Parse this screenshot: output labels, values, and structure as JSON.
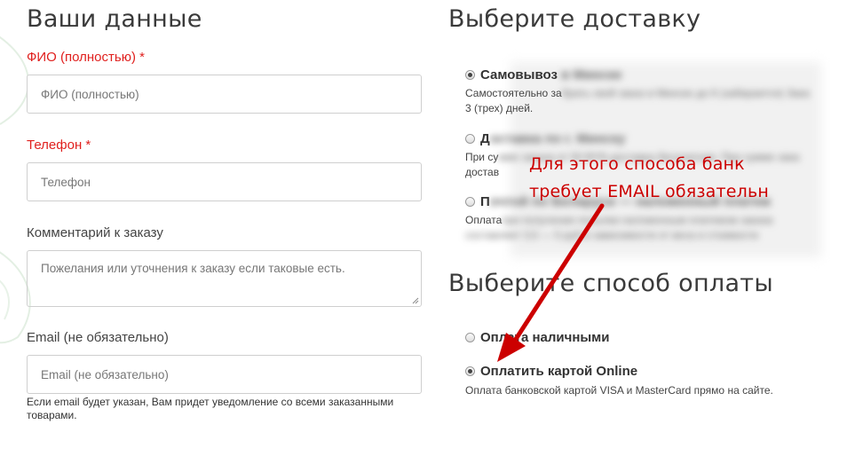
{
  "left": {
    "title": "Ваши данные",
    "fio": {
      "label": "ФИО (полностью)",
      "required": "*",
      "placeholder": "ФИО (полностью)"
    },
    "phone": {
      "label": "Телефон",
      "required": "*",
      "placeholder": "Телефон"
    },
    "comment": {
      "label": "Комментарий к заказу",
      "placeholder": "Пожелания или уточнения к заказу если таковые есть."
    },
    "email": {
      "label": "Email (не обязательно)",
      "placeholder": "Email (не обязательно)",
      "hint": "Если email будет указан, Вам придет уведомление со всеми заказанными товарами."
    }
  },
  "delivery": {
    "title": "Выберите доставку",
    "options": [
      {
        "label": "Самовывоз",
        "label_blurred": "в Минске",
        "selected": true,
        "desc_visible": "Самостоятельно за",
        "desc_blurred": "брать свой заказ в Минске до 6 (забирается) Зака",
        "desc_line2": "3 (трех) дней."
      },
      {
        "label": "Д",
        "label_blurred": "оставка по г. Минску",
        "selected": false,
        "desc_visible": "При су",
        "desc_blurred": "мме заказа от 50 BYN доставка бесплатная. При сумме зака",
        "desc_line2": "достав"
      },
      {
        "label": "П",
        "label_blurred": "очтой по Беларуси — наложенный платеж",
        "selected": false,
        "desc_visible": "Оплата",
        "desc_blurred": "при получении посылки наложенным платежом заказа",
        "desc_line2": "составляет 3,5 — 5 руб в зависимости от веса и стоимости"
      }
    ]
  },
  "payment": {
    "title": "Выберите способ оплаты",
    "options": [
      {
        "label": "Оплата наличными",
        "selected": false
      },
      {
        "label": "Оплатить картой Online",
        "selected": true,
        "desc": "Оплата банковской картой VISA и MasterCard прямо на сайте."
      }
    ]
  },
  "annotation": {
    "line1": "Для этого способа банк",
    "line2": "требует EMAIL обязательн",
    "color": "#cc0000"
  },
  "colors": {
    "required": "#e0201e",
    "text": "#333333",
    "border": "#cfcfcf"
  }
}
